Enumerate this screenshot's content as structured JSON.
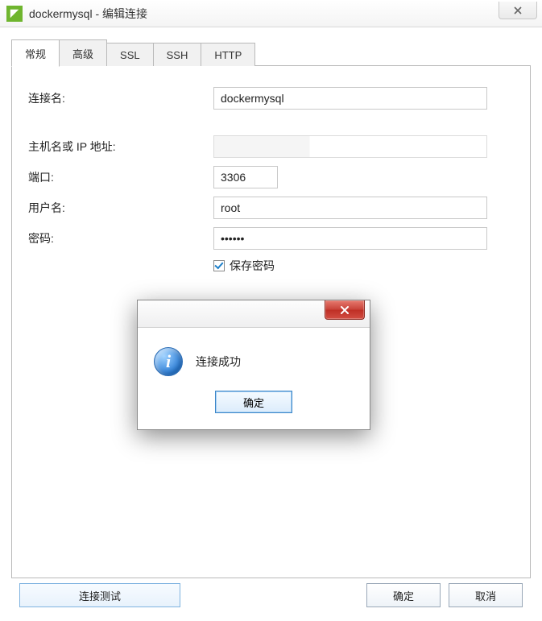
{
  "window": {
    "title": "dockermysql - 编辑连接"
  },
  "tabs": {
    "items": [
      {
        "label": "常规",
        "active": true
      },
      {
        "label": "高级",
        "active": false
      },
      {
        "label": "SSL",
        "active": false
      },
      {
        "label": "SSH",
        "active": false
      },
      {
        "label": "HTTP",
        "active": false
      }
    ]
  },
  "form": {
    "connection_name": {
      "label": "连接名:",
      "value": "dockermysql"
    },
    "host": {
      "label": "主机名或 IP 地址:",
      "value": ""
    },
    "port": {
      "label": "端口:",
      "value": "3306"
    },
    "username": {
      "label": "用户名:",
      "value": "root"
    },
    "password": {
      "label": "密码:",
      "value": "••••••"
    },
    "save_password": {
      "label": "保存密码",
      "checked": true
    }
  },
  "buttons": {
    "test": "连接测试",
    "ok": "确定",
    "cancel": "取消"
  },
  "dialog": {
    "message": "连接成功",
    "ok": "确定"
  }
}
